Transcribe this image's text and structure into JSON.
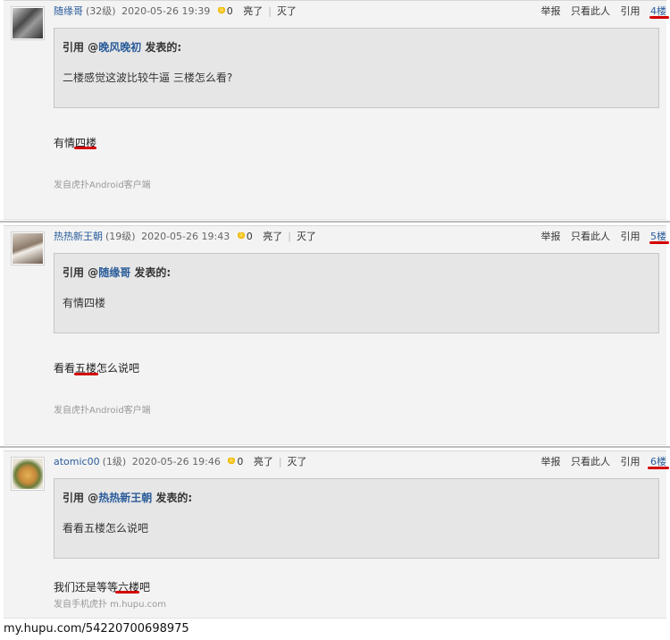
{
  "posts": [
    {
      "username": "随缘哥",
      "level": "(32级)",
      "time": "2020-05-26 19:39",
      "count": "0",
      "like_label": "亮了",
      "dislike_label": "灭了",
      "report_label": "举报",
      "only_label": "只看此人",
      "quote_label": "引用",
      "floor": "4楼",
      "quote": {
        "prefix": "引用 @",
        "user": "晚风晚初",
        "suffix": " 发表的:",
        "body": "二楼感觉这波比较牛逼 三楼怎么看?"
      },
      "content_pre": "有情",
      "content_mark": "四楼",
      "content_post": "",
      "source": "发自虎扑Android客户端"
    },
    {
      "username": "热热新王朝",
      "level": "(19级)",
      "time": "2020-05-26 19:43",
      "count": "0",
      "like_label": "亮了",
      "dislike_label": "灭了",
      "report_label": "举报",
      "only_label": "只看此人",
      "quote_label": "引用",
      "floor": "5楼",
      "quote": {
        "prefix": "引用 @",
        "user": "随缘哥",
        "suffix": " 发表的:",
        "body": "有情四楼"
      },
      "content_pre": "看看",
      "content_mark": "五楼",
      "content_post": "怎么说吧",
      "source": "发自虎扑Android客户端"
    },
    {
      "username": "atomic00",
      "level": "(1级)",
      "time": "2020-05-26 19:46",
      "count": "0",
      "like_label": "亮了",
      "dislike_label": "灭了",
      "report_label": "举报",
      "only_label": "只看此人",
      "quote_label": "引用",
      "floor": "6楼",
      "quote": {
        "prefix": "引用 @",
        "user": "热热新王朝",
        "suffix": " 发表的:",
        "body": "看看五楼怎么说吧"
      },
      "content_pre": "我们还是等等",
      "content_mark": "六楼",
      "content_post": "吧",
      "source": "发自手机虎扑 m.hupu.com"
    }
  ],
  "watermark": "my.hupu.com/54220700698975",
  "colors": {
    "link": "#2a5c9a",
    "highlight": "#d40000",
    "post_bg": "#f3f3f3",
    "quote_bg": "#e6e6e6"
  }
}
